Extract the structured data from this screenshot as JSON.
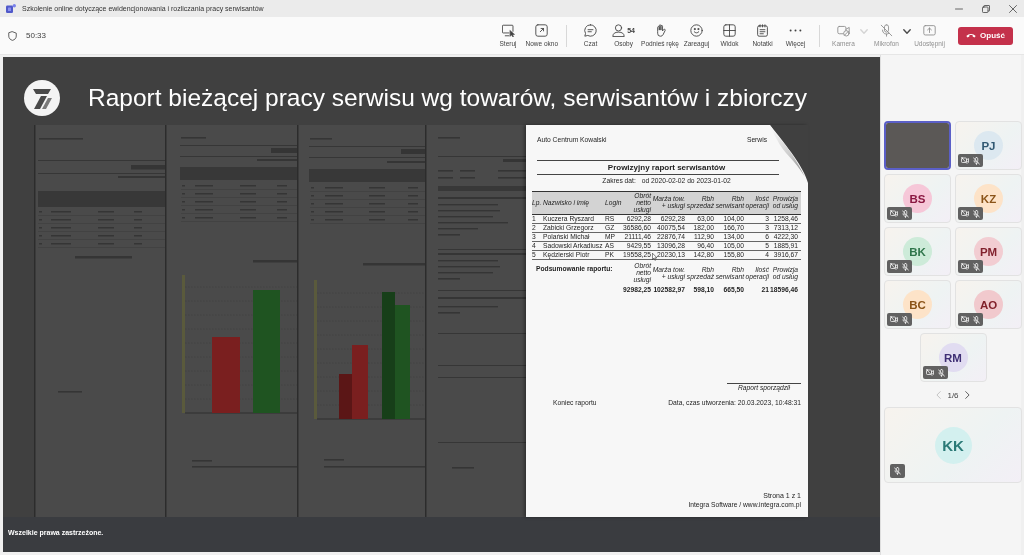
{
  "window": {
    "title": "Szkolenie online dotyczące ewidencjonowania i rozliczania pracy serwisantów"
  },
  "meeting_bar": {
    "timer": "50:33",
    "controls": [
      [
        {
          "label": "Steruj",
          "disabled": false,
          "dropdown": false
        },
        {
          "label": "Nowe okno",
          "disabled": false,
          "dropdown": false
        }
      ],
      [
        {
          "label": "Czat",
          "disabled": false,
          "dropdown": false
        },
        {
          "label": "Osoby",
          "count": "54",
          "disabled": false,
          "dropdown": false
        },
        {
          "label": "Podnieś rękę",
          "disabled": false,
          "dropdown": false
        },
        {
          "label": "Zareaguj",
          "disabled": false,
          "dropdown": false
        },
        {
          "label": "Widok",
          "disabled": false,
          "dropdown": false
        },
        {
          "label": "Notatki",
          "disabled": false,
          "dropdown": false
        },
        {
          "label": "Więcej",
          "disabled": false,
          "dropdown": false
        }
      ],
      [
        {
          "label": "Kamera",
          "disabled": true,
          "dropdown": true,
          "dropdown_disabled": true
        },
        {
          "label": "Mikrofon",
          "disabled": true,
          "dropdown": true,
          "dropdown_disabled": false
        },
        {
          "label": "Udostępnij",
          "disabled": true,
          "dropdown": false
        }
      ]
    ],
    "leave_button": "Opuść"
  },
  "shared_screen": {
    "slide_title": "Raport bieżącej pracy serwisu wg towarów, serwisantów i zbiorczy",
    "report": {
      "company": "Auto Centrum Kowalski",
      "department": "Serwis",
      "title": "Prowizyjny raport serwisantów",
      "date_label": "Zakres dat:",
      "date_range": "od 2020-02-02 do 2023-01-02",
      "columns": [
        "Lp.",
        "Nazwisko i imię",
        "Login",
        "Obrót netto usługi",
        "Marża tow. + usługi",
        "Rbh sprzedaż",
        "Rbh serwisant",
        "Ilość operacji",
        "Prowizja od usług"
      ],
      "rows": [
        [
          "1",
          "Kuczera Ryszard",
          "RS",
          "6292,28",
          "6292,28",
          "63,00",
          "104,00",
          "3",
          "1258,46"
        ],
        [
          "2",
          "Zabicki Grzegorz",
          "GZ",
          "36586,60",
          "40075,54",
          "182,00",
          "166,70",
          "3",
          "7313,12"
        ],
        [
          "3",
          "Polański Michał",
          "MP",
          "21111,46",
          "22876,74",
          "112,90",
          "134,00",
          "6",
          "4222,30"
        ],
        [
          "4",
          "Sadowski Arkadiusz",
          "AS",
          "9429,55",
          "13096,28",
          "96,40",
          "105,00",
          "5",
          "1885,91"
        ],
        [
          "5",
          "Kędzierski Piotr",
          "PK",
          "19558,25",
          "20230,13",
          "142,80",
          "155,80",
          "4",
          "3916,67"
        ]
      ],
      "summary_label": "Podsumowanie raportu:",
      "summary_columns": [
        "Obrót netto usługi",
        "Marża tow. + usługi",
        "Rbh sprzedaż",
        "Rbh serwisant",
        "Ilość operacji",
        "Prowizja od usług"
      ],
      "summary_values": [
        "92982,25",
        "102582,97",
        "598,10",
        "665,50",
        "21",
        "18596,46"
      ],
      "signature": "Raport sporządził",
      "end_note": "Koniec raportu",
      "created": "Data, czas utworzenia: 20.03.2023, 10:48:31",
      "page_number": "Strona 1 z 1",
      "vendor": "Integra Software / www.integra.com.pl"
    },
    "footer": "Wszelkie prawa zastrzeżone."
  },
  "participants": {
    "tiles": [
      {
        "kind": "video",
        "speaking": true,
        "muted": false,
        "camera_off": false
      },
      {
        "kind": "avatar",
        "initials": "PJ",
        "color": "#dce8f0",
        "speaking": false,
        "muted": true,
        "camera_off": true
      },
      {
        "kind": "avatar",
        "initials": "BS",
        "color": "#f6c7d8",
        "speaking": false,
        "muted": true,
        "camera_off": true
      },
      {
        "kind": "avatar",
        "initials": "KZ",
        "color": "#fde3c8",
        "speaking": false,
        "muted": true,
        "camera_off": true
      },
      {
        "kind": "avatar",
        "initials": "BK",
        "color": "#cdebd9",
        "speaking": false,
        "muted": true,
        "camera_off": true
      },
      {
        "kind": "avatar",
        "initials": "PM",
        "color": "#f2cdd2",
        "speaking": false,
        "muted": true,
        "camera_off": true
      },
      {
        "kind": "avatar",
        "initials": "BC",
        "color": "#fde3c8",
        "speaking": false,
        "muted": true,
        "camera_off": true
      },
      {
        "kind": "avatar",
        "initials": "AO",
        "color": "#f1c9cd",
        "speaking": false,
        "muted": true,
        "camera_off": true
      },
      {
        "kind": "avatar",
        "initials": "RM",
        "color": "#e1dcf1",
        "speaking": false,
        "muted": true,
        "camera_off": true
      }
    ],
    "pager": {
      "text": "1/6",
      "prev_disabled": true,
      "next_disabled": false
    },
    "spotlight": {
      "kind": "avatar",
      "initials": "KK",
      "color": "#d3f0ef",
      "speaking": false,
      "muted": true,
      "camera_off": false
    }
  }
}
